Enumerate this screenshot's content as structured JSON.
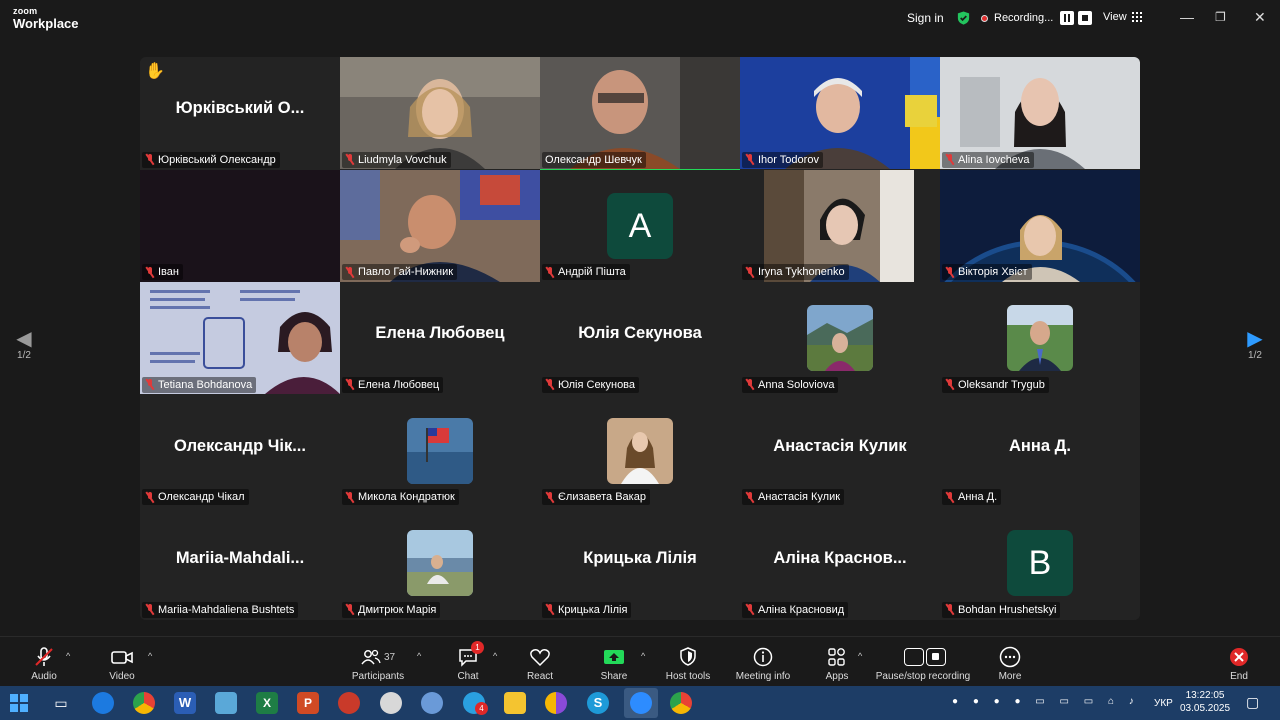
{
  "app": {
    "brand_small": "zoom",
    "brand_name": "Workplace"
  },
  "titlebar": {
    "sign_in": "Sign in",
    "recording_label": "Recording...",
    "view_label": "View",
    "colors": {
      "shield": "#23c45e",
      "record_dot": "#e02f2f"
    }
  },
  "pager": {
    "left_page": "1/2",
    "right_page": "1/2"
  },
  "tiles": [
    {
      "label": "Юрківський Олександр",
      "big_name": "Юрківський О...",
      "kind": "name",
      "hand_raised": true
    },
    {
      "label": "Liudmyla Vovchuk",
      "kind": "video"
    },
    {
      "label": "Олександр Шевчук",
      "kind": "video",
      "active_speaker": true
    },
    {
      "label": "Ihor Todorov",
      "kind": "video"
    },
    {
      "label": "Alina Iovcheva",
      "kind": "video"
    },
    {
      "label": "Іван",
      "kind": "blank"
    },
    {
      "label": "Павло Гай-Нижник",
      "kind": "video"
    },
    {
      "label": "Андрій Пішта",
      "kind": "letter",
      "letter": "A"
    },
    {
      "label": "Iryna Tykhonenko",
      "kind": "video"
    },
    {
      "label": "Вікторія Хвіст",
      "kind": "video"
    },
    {
      "label": "Tetiana Bohdanova",
      "kind": "video"
    },
    {
      "label": "Елена Любовец",
      "big_name": "Елена Любовец",
      "kind": "name"
    },
    {
      "label": "Юлія Секунова",
      "big_name": "Юлія Секунова",
      "kind": "name"
    },
    {
      "label": "Anna Soloviova",
      "kind": "photo"
    },
    {
      "label": "Oleksandr Trygub",
      "kind": "photo"
    },
    {
      "label": "Олександр Чікал",
      "big_name": "Олександр Чік...",
      "kind": "name"
    },
    {
      "label": "Микола Кондратюк",
      "kind": "photo"
    },
    {
      "label": "Єлизавета Вакар",
      "kind": "photo"
    },
    {
      "label": "Анастасія Кулик",
      "big_name": "Анастасія Кулик",
      "kind": "name"
    },
    {
      "label": "Анна Д.",
      "big_name": "Анна Д.",
      "kind": "name"
    },
    {
      "label": "Mariia-Mahdaliena Bushtets",
      "big_name": "Mariia-Mahdali...",
      "kind": "name"
    },
    {
      "label": "Дмитрюк Марія",
      "kind": "photo"
    },
    {
      "label": "Крицька Лілія",
      "big_name": "Крицька Лілія",
      "kind": "name"
    },
    {
      "label": "Аліна Красновид",
      "big_name": "Аліна Краснов...",
      "kind": "name"
    },
    {
      "label": "Bohdan Hrushetskyi",
      "kind": "letter",
      "letter": "B"
    }
  ],
  "toolbar": {
    "audio": "Audio",
    "video": "Video",
    "participants": "Participants",
    "participants_count": "37",
    "chat": "Chat",
    "chat_badge": "1",
    "react": "React",
    "share": "Share",
    "host_tools": "Host tools",
    "meeting_info": "Meeting info",
    "apps": "Apps",
    "pause_stop": "Pause/stop recording",
    "more": "More",
    "end": "End",
    "colors": {
      "share": "#23d959",
      "end": "#e02828"
    }
  },
  "taskbar": {
    "lang": "УКР",
    "time": "13:22:05",
    "date": "03.05.2025",
    "telegram_badge": "4"
  }
}
